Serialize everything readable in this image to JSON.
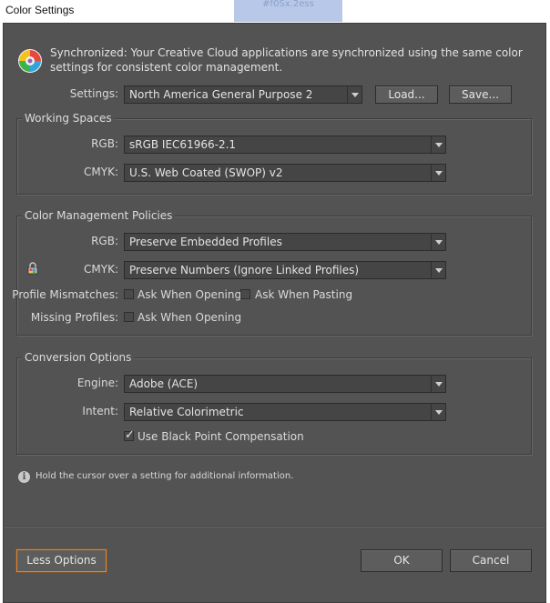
{
  "window": {
    "title": "Color Settings",
    "background_chip": "#f0Sx.2ess"
  },
  "sync": {
    "message": "Synchronized: Your Creative Cloud applications are synchronized using the same color settings for consistent color management."
  },
  "settings_row": {
    "label": "Settings:",
    "value": "North America General Purpose 2",
    "load_label": "Load...",
    "save_label": "Save..."
  },
  "working_spaces": {
    "title": "Working Spaces",
    "rgb_label": "RGB:",
    "rgb_value": "sRGB IEC61966-2.1",
    "cmyk_label": "CMYK:",
    "cmyk_value": "U.S. Web Coated (SWOP) v2"
  },
  "policies": {
    "title": "Color Management Policies",
    "rgb_label": "RGB:",
    "rgb_value": "Preserve Embedded Profiles",
    "cmyk_label": "CMYK:",
    "cmyk_value": "Preserve Numbers (Ignore Linked Profiles)",
    "mismatch_label": "Profile Mismatches:",
    "ask_opening": "Ask When Opening",
    "ask_pasting": "Ask When Pasting",
    "missing_label": "Missing Profiles:",
    "missing_ask_opening": "Ask When Opening",
    "mismatch_opening_checked": false,
    "mismatch_pasting_checked": false,
    "missing_opening_checked": false
  },
  "conversion": {
    "title": "Conversion Options",
    "engine_label": "Engine:",
    "engine_value": "Adobe (ACE)",
    "intent_label": "Intent:",
    "intent_value": "Relative Colorimetric",
    "bpc_label": "Use Black Point Compensation",
    "bpc_checked": true
  },
  "info": {
    "text": "Hold the cursor over a setting for additional information."
  },
  "footer": {
    "less_options": "Less Options",
    "ok": "OK",
    "cancel": "Cancel"
  },
  "colors": {
    "dialog_bg": "#535353",
    "accent_focus": "#d8893a"
  },
  "icons": [
    "creative-cloud-sync-icon",
    "lock-icon",
    "info-icon",
    "chevron-down-icon"
  ]
}
